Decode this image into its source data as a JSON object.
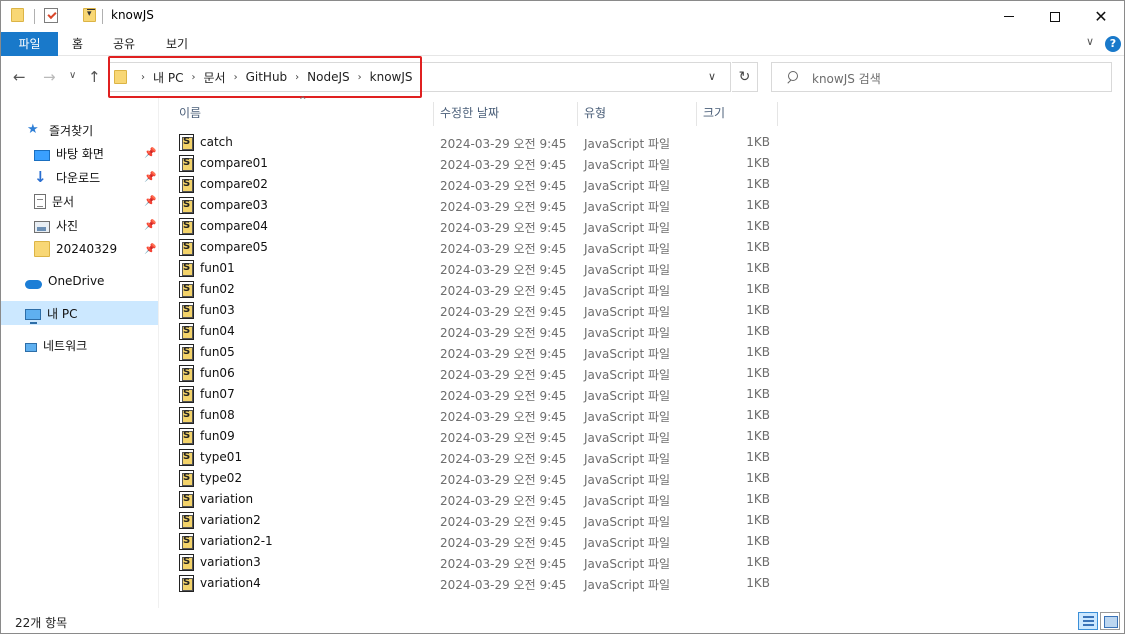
{
  "window": {
    "title": "knowJS",
    "controls": {
      "minimize": "minimize",
      "maximize": "maximize",
      "close": "✕"
    }
  },
  "ribbon": {
    "tabs": [
      "파일",
      "홈",
      "공유",
      "보기"
    ],
    "help": "?"
  },
  "address": {
    "crumbs": [
      "내 PC",
      "문서",
      "GitHub",
      "NodeJS",
      "knowJS"
    ],
    "separator": "›"
  },
  "search": {
    "placeholder": "knowJS 검색"
  },
  "nav_pane": {
    "quick_access": "즐겨찾기",
    "pinned": [
      "바탕 화면",
      "다운로드",
      "문서",
      "사진",
      "20240329"
    ],
    "onedrive": "OneDrive",
    "this_pc": "내 PC",
    "network": "네트워크"
  },
  "columns": {
    "name": "이름",
    "date": "수정한 날짜",
    "type": "유형",
    "size": "크기"
  },
  "files": [
    {
      "name": "catch",
      "date": "2024-03-29 오전 9:45",
      "type": "JavaScript 파일",
      "size": "1KB"
    },
    {
      "name": "compare01",
      "date": "2024-03-29 오전 9:45",
      "type": "JavaScript 파일",
      "size": "1KB"
    },
    {
      "name": "compare02",
      "date": "2024-03-29 오전 9:45",
      "type": "JavaScript 파일",
      "size": "1KB"
    },
    {
      "name": "compare03",
      "date": "2024-03-29 오전 9:45",
      "type": "JavaScript 파일",
      "size": "1KB"
    },
    {
      "name": "compare04",
      "date": "2024-03-29 오전 9:45",
      "type": "JavaScript 파일",
      "size": "1KB"
    },
    {
      "name": "compare05",
      "date": "2024-03-29 오전 9:45",
      "type": "JavaScript 파일",
      "size": "1KB"
    },
    {
      "name": "fun01",
      "date": "2024-03-29 오전 9:45",
      "type": "JavaScript 파일",
      "size": "1KB"
    },
    {
      "name": "fun02",
      "date": "2024-03-29 오전 9:45",
      "type": "JavaScript 파일",
      "size": "1KB"
    },
    {
      "name": "fun03",
      "date": "2024-03-29 오전 9:45",
      "type": "JavaScript 파일",
      "size": "1KB"
    },
    {
      "name": "fun04",
      "date": "2024-03-29 오전 9:45",
      "type": "JavaScript 파일",
      "size": "1KB"
    },
    {
      "name": "fun05",
      "date": "2024-03-29 오전 9:45",
      "type": "JavaScript 파일",
      "size": "1KB"
    },
    {
      "name": "fun06",
      "date": "2024-03-29 오전 9:45",
      "type": "JavaScript 파일",
      "size": "1KB"
    },
    {
      "name": "fun07",
      "date": "2024-03-29 오전 9:45",
      "type": "JavaScript 파일",
      "size": "1KB"
    },
    {
      "name": "fun08",
      "date": "2024-03-29 오전 9:45",
      "type": "JavaScript 파일",
      "size": "1KB"
    },
    {
      "name": "fun09",
      "date": "2024-03-29 오전 9:45",
      "type": "JavaScript 파일",
      "size": "1KB"
    },
    {
      "name": "type01",
      "date": "2024-03-29 오전 9:45",
      "type": "JavaScript 파일",
      "size": "1KB"
    },
    {
      "name": "type02",
      "date": "2024-03-29 오전 9:45",
      "type": "JavaScript 파일",
      "size": "1KB"
    },
    {
      "name": "variation",
      "date": "2024-03-29 오전 9:45",
      "type": "JavaScript 파일",
      "size": "1KB"
    },
    {
      "name": "variation2",
      "date": "2024-03-29 오전 9:45",
      "type": "JavaScript 파일",
      "size": "1KB"
    },
    {
      "name": "variation2-1",
      "date": "2024-03-29 오전 9:45",
      "type": "JavaScript 파일",
      "size": "1KB"
    },
    {
      "name": "variation3",
      "date": "2024-03-29 오전 9:45",
      "type": "JavaScript 파일",
      "size": "1KB"
    },
    {
      "name": "variation4",
      "date": "2024-03-29 오전 9:45",
      "type": "JavaScript 파일",
      "size": "1KB"
    }
  ],
  "status": {
    "item_count": "22개 항목"
  },
  "colors": {
    "accent": "#1979ca",
    "selection": "#cce8ff",
    "highlight_box": "#e02020"
  }
}
